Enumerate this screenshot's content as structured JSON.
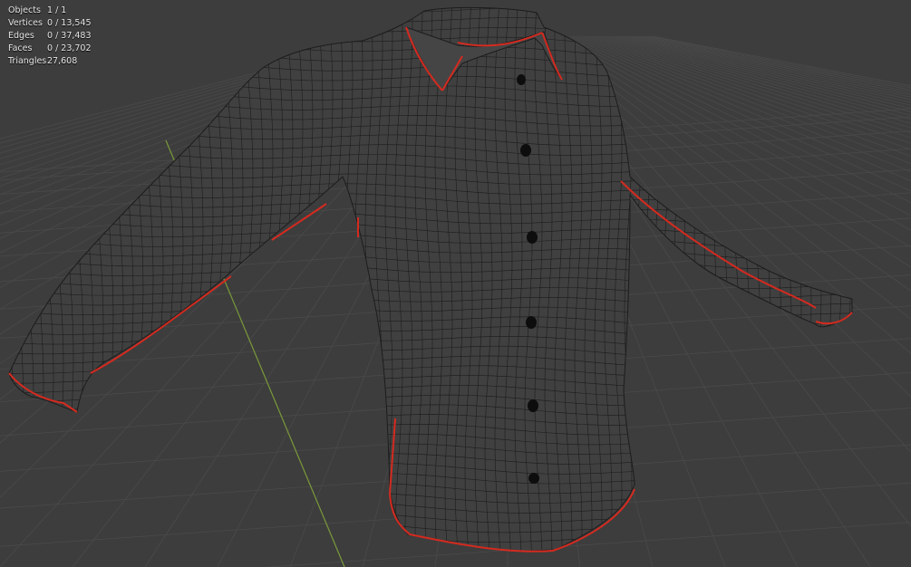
{
  "viewport": {
    "background_color": "#3d3d3d",
    "grid_color": "#4a4a4a",
    "y_axis_color": "#7a9a3a",
    "mesh_fill_color": "#404040",
    "wire_color": "#1c1c1c",
    "seam_color": "#d42a1f",
    "button_color": "#0d0d0d",
    "object_icon": "shirt-mesh"
  },
  "stats": [
    {
      "label": "Objects",
      "value": "1 / 1"
    },
    {
      "label": "Vertices",
      "value": "0 / 13,545"
    },
    {
      "label": "Edges",
      "value": "0 / 37,483"
    },
    {
      "label": "Faces",
      "value": "0 / 23,702"
    },
    {
      "label": "Triangles",
      "value": "27,608"
    }
  ]
}
